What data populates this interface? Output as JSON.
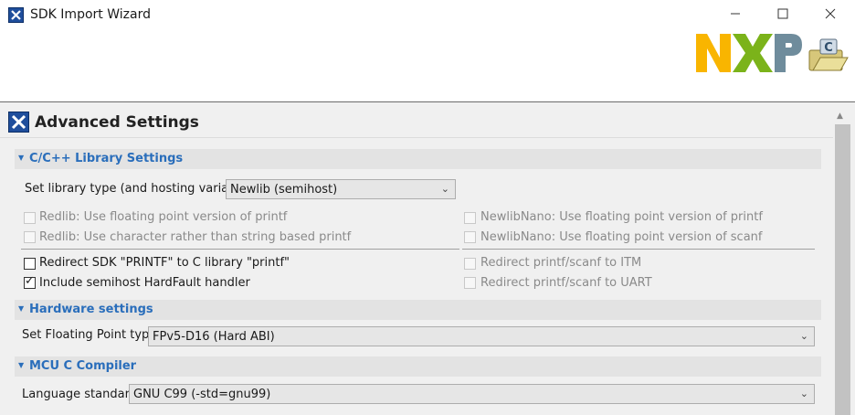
{
  "window": {
    "title": "SDK Import Wizard",
    "min_icon": "minimize-icon",
    "max_icon": "maximize-icon",
    "close_icon": "close-icon"
  },
  "header": {
    "logo_text": "NXP",
    "logo_colors": [
      "#f9b500",
      "#7bb31a",
      "#6f8c9c"
    ],
    "folder_badge": "C"
  },
  "page": {
    "title": "Advanced Settings"
  },
  "library": {
    "section_title": "C/C++ Library Settings",
    "type_label": "Set library type (and hosting variant)",
    "type_value": "Newlib (semihost)",
    "left_options": [
      {
        "label": "Redlib: Use floating point version of printf",
        "checked": false,
        "enabled": false
      },
      {
        "label": "Redlib: Use character rather than string based printf",
        "checked": false,
        "enabled": false
      },
      {
        "label": "Redirect SDK \"PRINTF\" to C library \"printf\"",
        "checked": false,
        "enabled": true
      },
      {
        "label": "Include semihost HardFault handler",
        "checked": true,
        "enabled": true
      }
    ],
    "right_options": [
      {
        "label": "NewlibNano: Use floating point version of printf",
        "checked": false,
        "enabled": false
      },
      {
        "label": "NewlibNano: Use floating point version of scanf",
        "checked": false,
        "enabled": false
      },
      {
        "label": "Redirect printf/scanf to ITM",
        "checked": false,
        "enabled": false
      },
      {
        "label": "Redirect printf/scanf to UART",
        "checked": false,
        "enabled": false
      }
    ]
  },
  "hardware": {
    "section_title": "Hardware settings",
    "fp_label": "Set Floating Point type",
    "fp_value": "FPv5-D16 (Hard ABI)"
  },
  "compiler": {
    "section_title": "MCU C Compiler",
    "lang_label": "Language standard",
    "lang_value": "GNU C99 (-std=gnu99)"
  },
  "colors": {
    "accent": "#2a6ebb",
    "section_bg": "#e3e3e3"
  }
}
